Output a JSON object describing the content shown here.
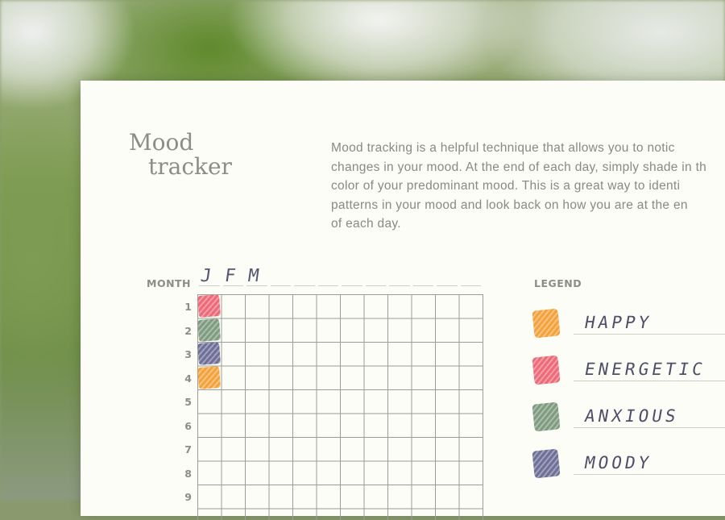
{
  "title_line1": "Mood",
  "title_line2": "tracker",
  "intro_lines": [
    "Mood tracking is a helpful technique that allows you to notic",
    "changes in your mood. At the end of each day, simply shade in th",
    "color of your predominant mood. This is a great way to identi",
    "patterns in your mood and look back on how you are at the en",
    "of each day."
  ],
  "month_label": "MONTH",
  "months_written": [
    "J",
    "F",
    "M"
  ],
  "row_numbers": [
    "1",
    "2",
    "3",
    "4",
    "5",
    "6",
    "7",
    "8",
    "9"
  ],
  "shaded_days": [
    {
      "day": "1",
      "mood": "Energetic",
      "color": "#ee6a78"
    },
    {
      "day": "2",
      "mood": "Anxious",
      "color": "#7e9c80"
    },
    {
      "day": "3",
      "mood": "Moody",
      "color": "#6e7098"
    },
    {
      "day": "4",
      "mood": "Happy",
      "color": "#f4a23c"
    }
  ],
  "legend_label": "LEGEND",
  "legend": [
    {
      "label": "HAPPY",
      "color": "#f4a23c"
    },
    {
      "label": "ENERGETIC",
      "color": "#ee6a78"
    },
    {
      "label": "ANXIOUS",
      "color": "#7e9c80"
    },
    {
      "label": "MOODY",
      "color": "#6e7098"
    }
  ]
}
